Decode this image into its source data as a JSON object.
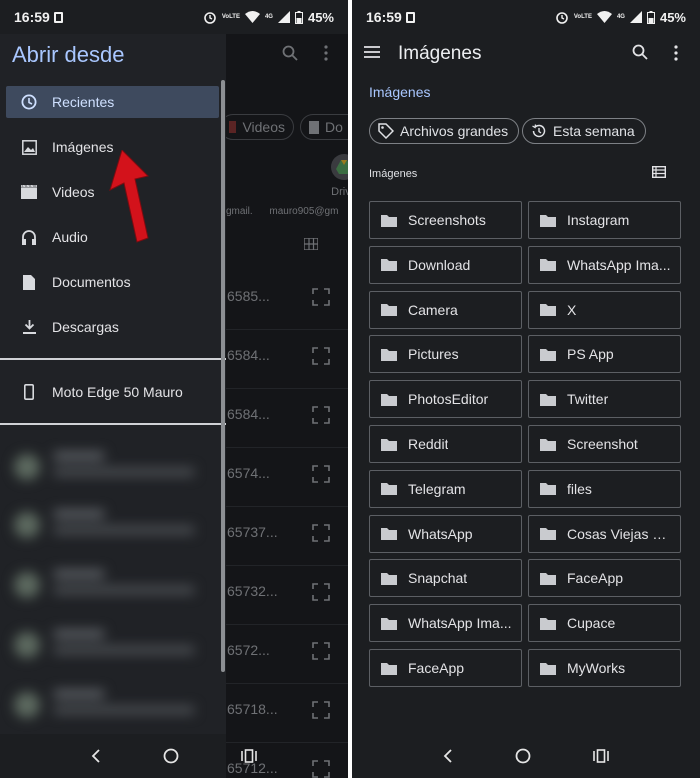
{
  "status": {
    "time": "16:59",
    "battery": "45%",
    "volte": "VoLTE",
    "network": "4G"
  },
  "left": {
    "drawer_title": "Abrir desde",
    "items": [
      {
        "label": "Recientes",
        "icon": "clock-icon",
        "active": true
      },
      {
        "label": "Imágenes",
        "icon": "image-icon",
        "active": false
      },
      {
        "label": "Videos",
        "icon": "video-icon",
        "active": false
      },
      {
        "label": "Audio",
        "icon": "audio-icon",
        "active": false
      },
      {
        "label": "Documentos",
        "icon": "document-icon",
        "active": false
      },
      {
        "label": "Descargas",
        "icon": "download-icon",
        "active": false
      }
    ],
    "device": {
      "label": "Moto Edge 50 Mauro",
      "icon": "phone-icon"
    },
    "background_app": {
      "chips": [
        "Videos",
        "Do"
      ],
      "drive_label": "Drive",
      "accounts": [
        "gmail.",
        "mauro905@gm"
      ],
      "file_numbers": [
        "6585...",
        "6584...",
        "6584...",
        "6574...",
        "65737...",
        "65732...",
        "6572...",
        "65718...",
        "65712..."
      ]
    }
  },
  "right": {
    "title": "Imágenes",
    "breadcrumb": "Imágenes",
    "chips": [
      {
        "label": "Archivos grandes",
        "icon": "tag-icon"
      },
      {
        "label": "Esta semana",
        "icon": "history-icon"
      }
    ],
    "section_label": "Imágenes",
    "folders": [
      "Screenshots",
      "Instagram",
      "Download",
      "WhatsApp Ima...",
      "Camera",
      "X",
      "Pictures",
      "PS App",
      "PhotosEditor",
      "Twitter",
      "Reddit",
      "Screenshot",
      "Telegram",
      "files",
      "WhatsApp",
      "Cosas Viejas W...",
      "Snapchat",
      "FaceApp",
      "WhatsApp Ima...",
      "Cupace",
      "FaceApp",
      "MyWorks"
    ]
  },
  "colors": {
    "accent": "#a9c7ff",
    "background": "#1c1e21",
    "drawer": "#202226",
    "active_item": "#3e4a5e",
    "arrow": "#d3121b"
  }
}
